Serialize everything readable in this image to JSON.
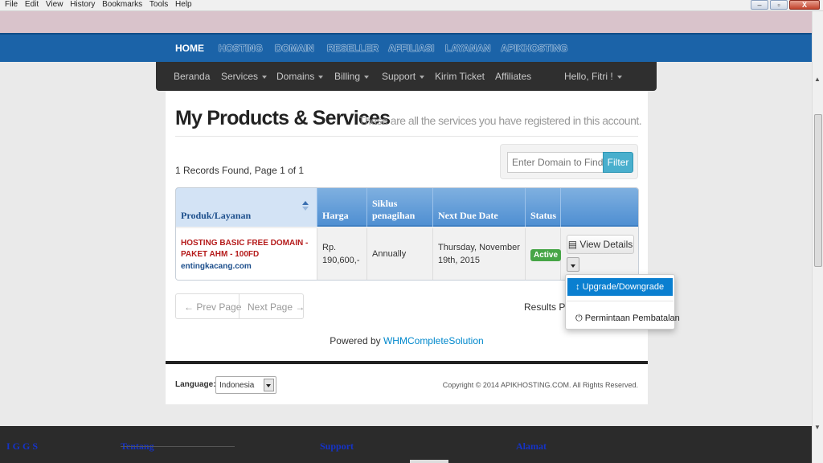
{
  "browser": {
    "menu": [
      "File",
      "Edit",
      "View",
      "History",
      "Bookmarks",
      "Tools",
      "Help"
    ],
    "win_minimize": "–",
    "win_restore": "▫",
    "win_close": "X"
  },
  "topnav": {
    "items": [
      "HOME",
      "HOSTING",
      "DOMAIN",
      "RESELLER",
      "AFFILIASI",
      "LAYANAN",
      "APIKHOSTING"
    ]
  },
  "subnav": {
    "beranda": "Beranda",
    "services": "Services",
    "domains": "Domains",
    "billing": "Billing",
    "support": "Support",
    "kirim_ticket": "Kirim Ticket",
    "affiliates": "Affiliates",
    "user": "Hello, Fitri !"
  },
  "page": {
    "title": "My Products & Services",
    "subtitle": "These are all the services you have registered in this account.",
    "records": "1 Records Found, Page 1 of 1",
    "filter_placeholder": "Enter Domain to Find",
    "filter_button": "Filter"
  },
  "table": {
    "headers": [
      "Produk/Layanan",
      "Harga",
      "Siklus penagihan",
      "Next Due Date",
      "Status"
    ],
    "rows": [
      {
        "product": "HOSTING BASIC FREE DOMAIN - PAKET AHM - 100FD",
        "domain": "entingkacang.com",
        "price": "Rp. 190,600,-",
        "cycle": "Annually",
        "due": "Thursday, November 19th, 2015",
        "status": "Active",
        "action": "View Details"
      }
    ]
  },
  "pager": {
    "prev": "← Prev Page",
    "next": "Next Page →",
    "results": "Results Per"
  },
  "powered": {
    "prefix": "Powered by ",
    "link": "WHMCompleteSolution"
  },
  "dropdown": {
    "upgrade": "Upgrade/Downgrade",
    "cancel": "Permintaan Pembatalan"
  },
  "footer": {
    "language_label": "Language:",
    "language_value": "Indonesia",
    "copyright": "Copyright © 2014 APIKHOSTING.COM. All Rights Reserved."
  },
  "bottom": {
    "col1": "Tentang",
    "col2": "Support",
    "col3": "Alamat",
    "logo": "IGGS"
  },
  "colors": {
    "nav_blue": "#1b63a8",
    "table_head": "#4f8fd2",
    "active_badge": "#46a546",
    "dropdown_active": "#0a7fd0"
  }
}
